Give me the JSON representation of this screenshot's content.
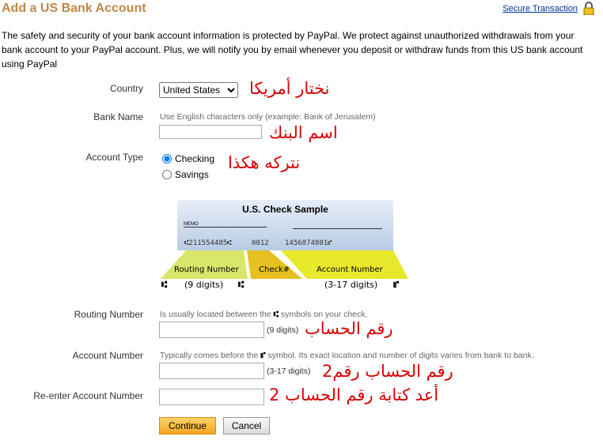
{
  "header": {
    "title": "Add a US Bank Account",
    "secure_link": "Secure Transaction",
    "lock_icon": "padlock-icon"
  },
  "intro": "The safety and security of your bank account information is protected by PayPal. We protect against unauthorized withdrawals from your bank account to your PayPal account. Plus, we will notify you by email whenever you deposit or withdraw funds from this US bank account using PayPal",
  "form": {
    "country": {
      "label": "Country",
      "value": "United States",
      "note": "نختار أمريكا"
    },
    "bank_name": {
      "label": "Bank Name",
      "hint": "Use English characters only (example: Bank of Jerusalem)",
      "value": "",
      "note": "اسم البنك"
    },
    "account_type": {
      "label": "Account Type",
      "options": [
        "Checking",
        "Savings"
      ],
      "selected": "Checking",
      "note": "نتركه هكذا"
    },
    "routing": {
      "label": "Routing Number",
      "hint_before": "Is usually located between the",
      "hint_after": "symbols on your check.",
      "digits": "(9 digits)",
      "value": "",
      "note": "رقم الحساب"
    },
    "account": {
      "label": "Account Number",
      "hint_before": "Typically comes before the",
      "hint_after": "symbol. Its exact location and number of digits varies from bank to bank.",
      "digits": "(3-17 digits)",
      "value": "",
      "note": "رقم الحساب رقم2"
    },
    "reenter": {
      "label": "Re-enter Account Number",
      "value": "",
      "note": "أعد كتابة رقم الحساب 2"
    },
    "continue": "Continue",
    "cancel": "Cancel"
  },
  "check": {
    "title": "U.S. Check Sample",
    "memo": "MEMO",
    "micr_routing": "⑆211554485⑆",
    "micr_check": "0012",
    "micr_account": "1456874801⑈",
    "routing_label": "Routing Number",
    "check_label": "Check#",
    "account_label": "Account Number",
    "routing_digits": "(9 digits)",
    "account_digits": "(3-17 digits)",
    "transit_symbol": "⑆",
    "onus_symbol": "⑈",
    "colors": {
      "routing": "#d8e66a",
      "check": "#e6c020",
      "account": "#e8e82a",
      "check_bg": "#b8cce4"
    }
  }
}
